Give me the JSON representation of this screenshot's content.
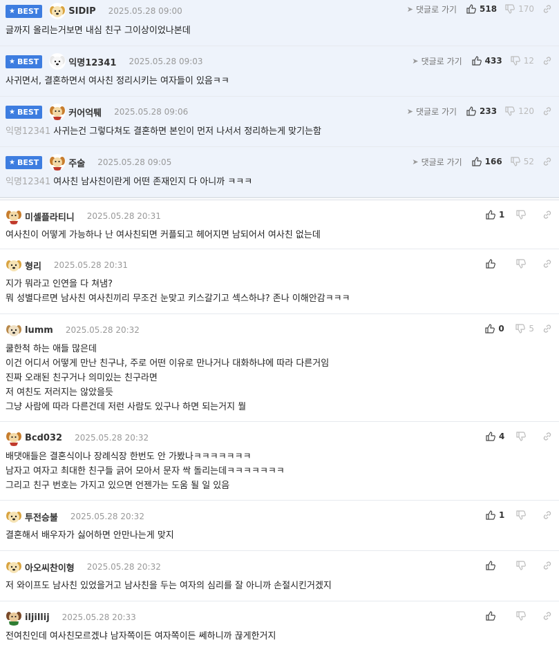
{
  "labels": {
    "best": "BEST",
    "goto": "댓글로 가기"
  },
  "best_comments": [
    {
      "nick": "SIDIP",
      "date": "2025.05.28 09:00",
      "likes": "518",
      "dislikes": "170",
      "mention": "",
      "lines": [
        "글까지 올리는거보면 내심 친구 그이상이었나본데"
      ]
    },
    {
      "nick": "익명12341",
      "date": "2025.05.28 09:03",
      "likes": "433",
      "dislikes": "12",
      "mention": "",
      "lines": [
        "사귀면서, 결혼하면서 여사친 정리시키는 여자들이 있음ㅋㅋ"
      ]
    },
    {
      "nick": "커어억퉤",
      "date": "2025.05.28 09:06",
      "likes": "233",
      "dislikes": "120",
      "mention": "익명12341",
      "lines": [
        "사귀는건 그렇다쳐도 결혼하면 본인이 먼저 나서서 정리하는게 맞기는함"
      ]
    },
    {
      "nick": "주술",
      "date": "2025.05.28 09:05",
      "likes": "166",
      "dislikes": "52",
      "mention": "익명12341",
      "lines": [
        "여사친 남사친이란게 어떤 존재인지 다 아니까 ㅋㅋㅋ"
      ]
    }
  ],
  "comments": [
    {
      "nick": "미셸플라티니",
      "date": "2025.05.28 20:31",
      "likes": "1",
      "dislikes": "",
      "lines": [
        "여사친이 어떻게 가능하나 난 여사친되면 커플되고 헤어지면 남되어서 여사친 없는데"
      ]
    },
    {
      "nick": "형리",
      "date": "2025.05.28 20:31",
      "likes": "",
      "dislikes": "",
      "lines": [
        "지가 뭐라고 인연을 다 쳐냄?",
        "뭐 성별다르면 남사친 여사친끼리 무조건 눈맞고 키스갈기고 섹스하냐? 존나 이해안감ㅋㅋㅋ"
      ]
    },
    {
      "nick": "lumm",
      "date": "2025.05.28 20:32",
      "likes": "0",
      "dislikes": "5",
      "lines": [
        "쿨한척 하는 애들 많은데",
        "이건 어디서 어떻게 만난 친구냐, 주로 어떤 이유로 만나거나 대화하냐에 따라 다른거임",
        "진짜 오래된 친구거나 의미있는 친구라면",
        "저 여친도 저러지는 않았을듯",
        "그냥 사람에 따라 다른건데 저런 사람도 있구나 하면 되는거지 뭘"
      ]
    },
    {
      "nick": "Bcd032",
      "date": "2025.05.28 20:32",
      "likes": "4",
      "dislikes": "",
      "lines": [
        "배댓애들은 결혼식이나 장례식장 한번도 안 가봤나ㅋㅋㅋㅋㅋㅋㅋ",
        "남자고 여자고 최대한 친구들 긁어 모아서 문자 싹 돌리는데ㅋㅋㅋㅋㅋㅋㅋ",
        "그리고 친구 번호는 가지고 있으면 언젠가는 도움 될 일 있음"
      ]
    },
    {
      "nick": "투전승불",
      "date": "2025.05.28 20:32",
      "likes": "1",
      "dislikes": "",
      "lines": [
        "결혼해서 배우자가 싫어하면 안만나는게 맞지"
      ]
    },
    {
      "nick": "아오씨찬이형",
      "date": "2025.05.28 20:32",
      "likes": "",
      "dislikes": "",
      "lines": [
        "저 와이프도 남사친 있었을거고 남사친을 두는 여자의 심리를 잘 아니까 손절시킨거겠지"
      ]
    },
    {
      "nick": "iljillij",
      "date": "2025.05.28 20:33",
      "likes": "",
      "dislikes": "",
      "lines": [
        "전여친인데 여사친모르겠냐 남자쪽이든 여자쪽이든 쎄하니까 끊게한거지"
      ]
    }
  ],
  "colors": {
    "best_bg": "#eef3fb",
    "badge": "#3d7de0"
  }
}
